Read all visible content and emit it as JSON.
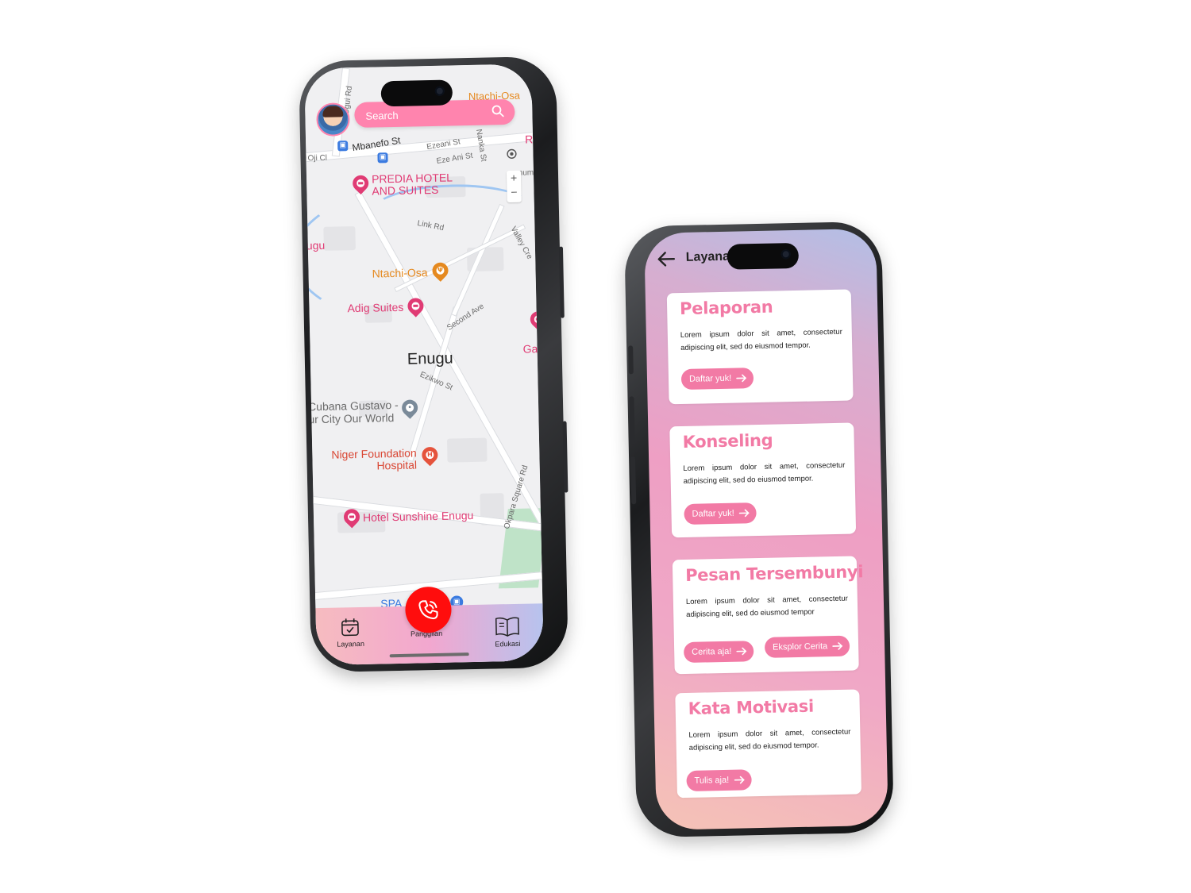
{
  "map_screen": {
    "search": {
      "placeholder": "Search"
    },
    "map": {
      "city_label": "Enugu",
      "streets": [
        "Ogui Rd",
        "Mbanefo St",
        "Ezeani St",
        "Eze Ani St",
        "Nanka St",
        "Link Rd",
        "Valley Cre",
        "Second Ave",
        "Ezikwo St",
        "Okpara Square Rd",
        "Oji Cl"
      ],
      "places": {
        "predia": [
          "PREDIA HOTEL",
          "AND SUITES"
        ],
        "ntachi_top": "Ntachi-Osa",
        "ntachi": "Ntachi-Osa",
        "adig": "Adig Suites",
        "cubana": [
          "Cubana Gustavo -",
          "ur City Our World"
        ],
        "niger": [
          "Niger Foundation",
          "Hospital"
        ],
        "sunshine": "Hotel Sunshine Enugu",
        "spa": "SPA",
        "edge_left": "ugu",
        "edge_right": "Ga",
        "edge_right_top": "R",
        "edge_mum": "mum"
      }
    },
    "bottom_nav": [
      {
        "label": "Layanan",
        "icon": "calendar-check-icon"
      },
      {
        "label": "Panggilan",
        "icon": "phone-call-icon"
      },
      {
        "label": "Edukasi",
        "icon": "open-book-icon"
      }
    ],
    "colors": {
      "accent": "#ff84ae",
      "call": "#ff0d0d"
    }
  },
  "services_screen": {
    "header": {
      "title": "Layanan"
    },
    "cards": [
      {
        "title": "Pelaporan",
        "body": "Lorem ipsum dolor sit amet, consectetur adipiscing elit, sed do eiusmod tempor.",
        "buttons": [
          "Daftar yuk!"
        ]
      },
      {
        "title": "Konseling",
        "body": "Lorem ipsum dolor sit amet, consectetur adipiscing elit, sed do eiusmod tempor.",
        "buttons": [
          "Daftar yuk!"
        ]
      },
      {
        "title": "Pesan Tersembunyi",
        "body": "Lorem ipsum dolor sit amet, consectetur adipiscing elit, sed do eiusmod tempor",
        "buttons": [
          "Cerita aja!",
          "Eksplor Cerita"
        ]
      },
      {
        "title": "Kata Motivasi",
        "body": "Lorem ipsum dolor sit amet, consectetur adipiscing elit, sed do eiusmod tempor.",
        "buttons": [
          "Tulis aja!"
        ]
      }
    ],
    "colors": {
      "title": "#f27aa5",
      "button": "#f27aa5"
    }
  }
}
